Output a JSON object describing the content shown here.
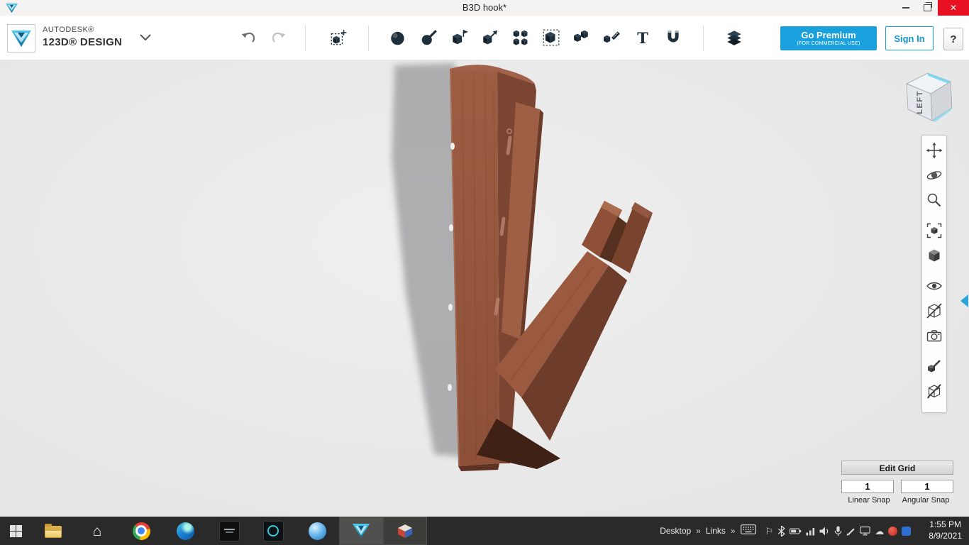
{
  "window": {
    "title": "B3D hook*",
    "controls": {
      "close_glyph": "✕"
    }
  },
  "toolbar": {
    "brand": {
      "autodesk": "AUTODESK®",
      "product": "123D® DESIGN"
    },
    "buttons": {
      "go_premium": "Go Premium",
      "go_premium_sub": "(FOR COMMERCIAL USE)",
      "sign_in": "Sign In",
      "help": "?"
    },
    "text_tool": "T",
    "tool_icons": [
      "transform",
      "primitives",
      "sketch",
      "construct",
      "modify",
      "pattern",
      "grouping",
      "combine",
      "measure",
      "text",
      "snap",
      "material"
    ]
  },
  "viewcube": {
    "face_label": "LEFT"
  },
  "view_toolbar_icons": [
    "pan",
    "orbit",
    "zoom",
    "zoom-fit",
    "shaded-view",
    "visibility",
    "hide-cube",
    "screenshot",
    "edit-material",
    "toggle-outline"
  ],
  "edit_grid": {
    "title": "Edit Grid",
    "linear": {
      "value": "1",
      "label": "Linear Snap"
    },
    "angular": {
      "value": "1",
      "label": "Angular Snap"
    }
  },
  "taskbar": {
    "desktop_label": "Desktop",
    "links_label": "Links",
    "overflow_chevron": "»",
    "glyphs": {
      "home": "⌂",
      "flag": "⚐",
      "cloud": "☁"
    },
    "app_icons": [
      "start",
      "file-explorer",
      "home",
      "chrome",
      "edge",
      "dark-app-1",
      "dark-app-2",
      "blue-sphere-app",
      "123d-design",
      "3d-model-app"
    ],
    "tray_icons": [
      "touch-keyboard",
      "action-center-flag",
      "bluetooth",
      "battery",
      "signal",
      "volume",
      "microphone",
      "pen",
      "display",
      "onedrive-cloud",
      "antivirus",
      "tray-app"
    ],
    "clock": {
      "time": "1:55 PM",
      "date": "8/9/2021"
    }
  },
  "colors": {
    "accent_blue": "#1aa0dc",
    "close_red": "#e81123",
    "model_brown": "#95563d",
    "taskbar_bg": "#2a2a2a"
  }
}
